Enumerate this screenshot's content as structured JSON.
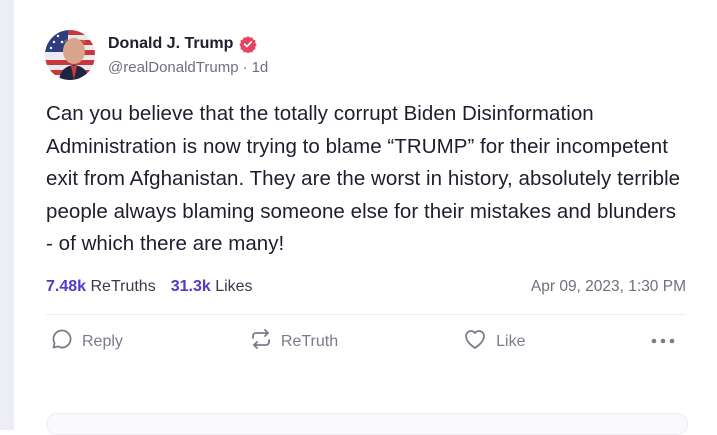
{
  "post": {
    "author": {
      "display_name": "Donald J. Trump",
      "handle": "@realDonaldTrump",
      "separator": "·",
      "age": "1d",
      "verified_icon": "verified-badge-icon",
      "verified_color": "#e5435f"
    },
    "content": "Can you believe that the totally corrupt Biden Disinformation Administration is now trying to blame “TRUMP” for their incompetent exit from Afghanistan. They are the worst in history, absolutely terrible people always blaming someone else for their mistakes and blunders - of which there are many!",
    "stats": {
      "retruths_count": "7.48k",
      "retruths_label": "ReTruths",
      "likes_count": "31.3k",
      "likes_label": "Likes",
      "count_color": "#4f3bc5"
    },
    "timestamp": "Apr 09, 2023, 1:30 PM",
    "actions": {
      "reply_label": "Reply",
      "retruth_label": "ReTruth",
      "like_label": "Like",
      "more_icon": "more-horizontal-icon"
    }
  }
}
